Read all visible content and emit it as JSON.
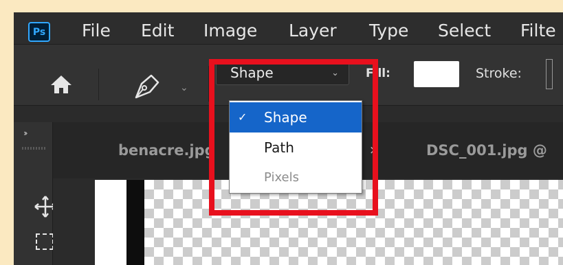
{
  "app": {
    "logo_text": "Ps"
  },
  "menubar": {
    "items": [
      "File",
      "Edit",
      "Image",
      "Layer",
      "Type",
      "Select",
      "Filte"
    ]
  },
  "options_bar": {
    "home_icon": "home-icon",
    "tool_icon": "pen-icon",
    "mode_select": {
      "value": "Shape"
    },
    "fill_label": "Fill:",
    "fill_color": "#ffffff",
    "stroke_label": "Stroke:"
  },
  "mode_dropdown": {
    "items": [
      {
        "label": "Shape",
        "state": "selected",
        "check": "✓"
      },
      {
        "label": "Path",
        "state": "normal",
        "check": ""
      },
      {
        "label": "Pixels",
        "state": "disabled",
        "check": ""
      }
    ]
  },
  "toolbar": {
    "collapse_glyph": "››",
    "tools": [
      "move-icon",
      "rectangular-marquee-icon"
    ]
  },
  "tabs": [
    {
      "label": "benacre.jpg",
      "close": "×"
    },
    {
      "label": "DSC_001.jpg @",
      "close": ""
    }
  ],
  "colors": {
    "highlight": "#e8101d",
    "selection": "#1565c9",
    "background_border": "#fbe9c1"
  }
}
